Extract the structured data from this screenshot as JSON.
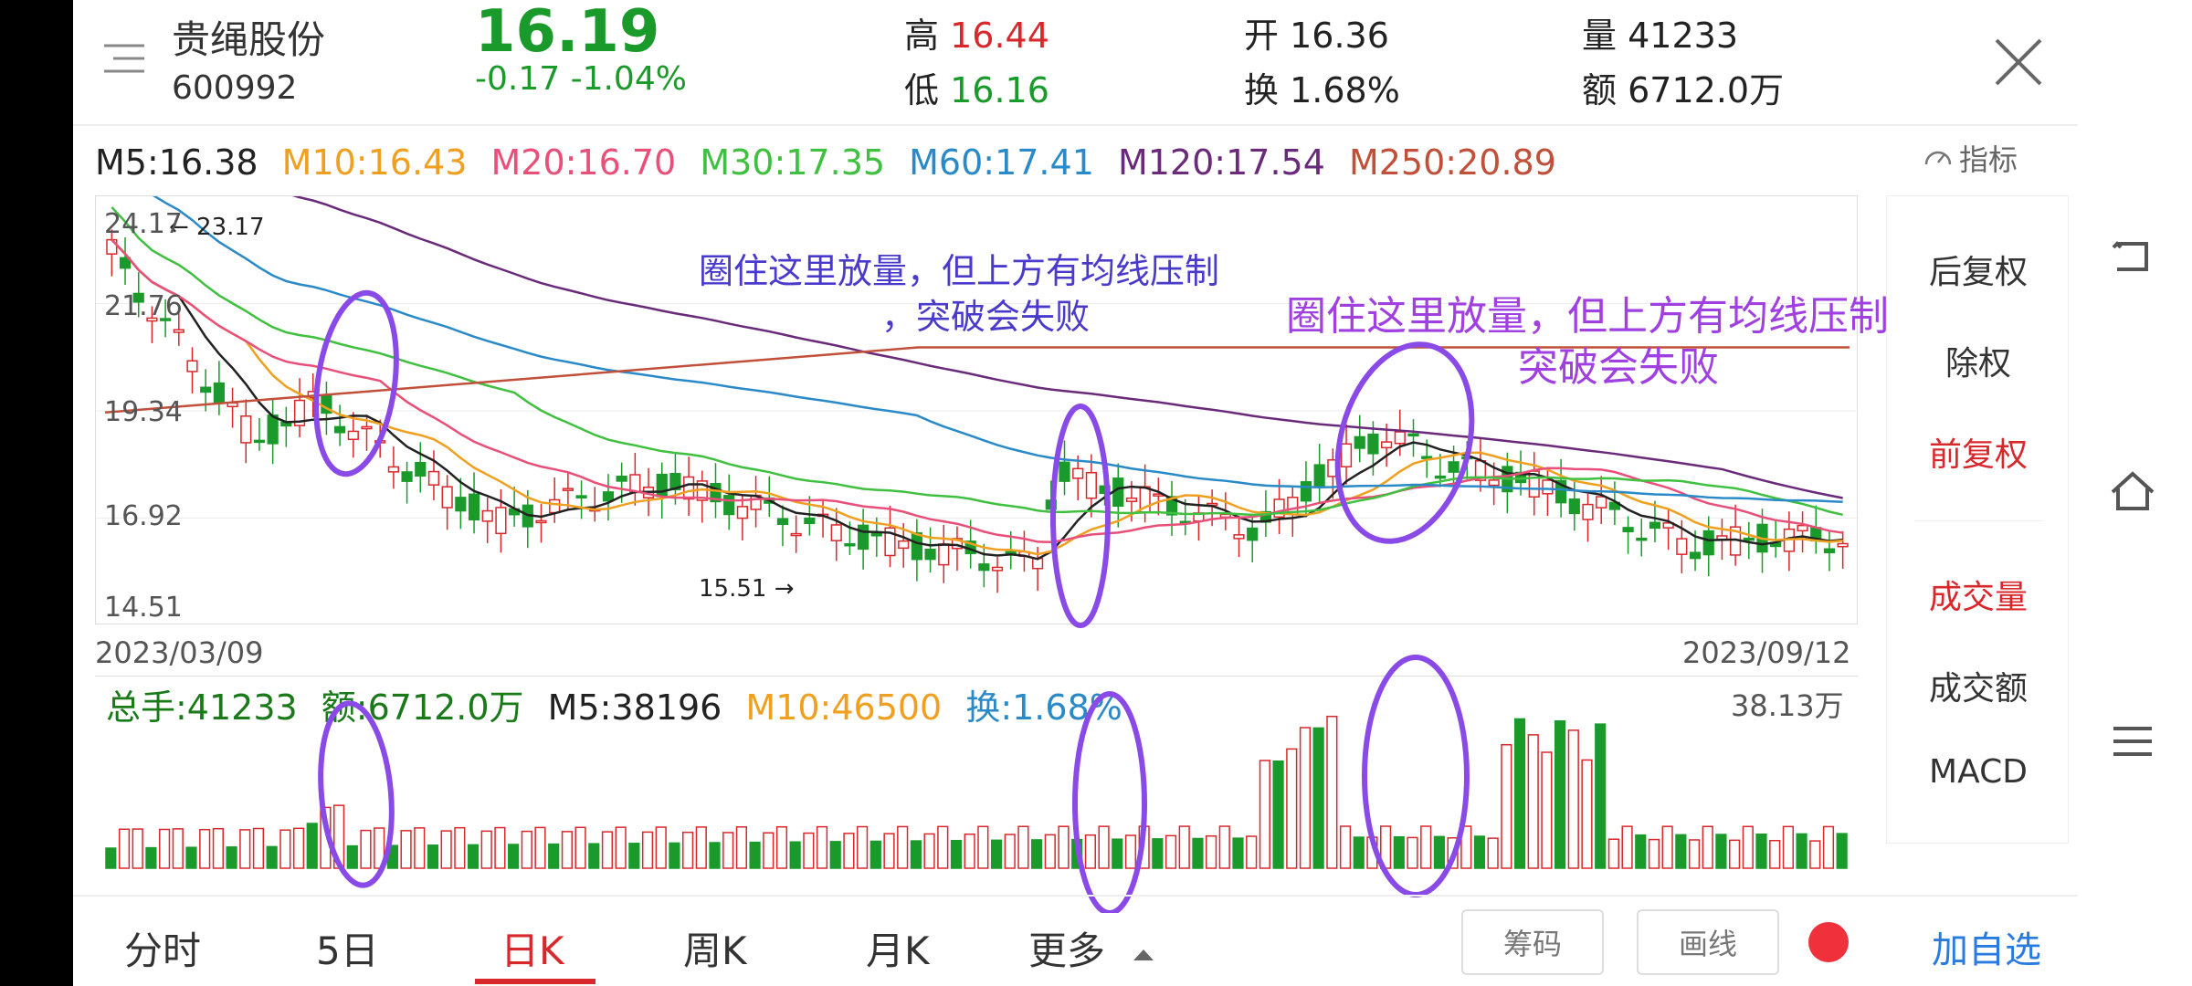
{
  "header": {
    "stock_name": "贵绳股份",
    "stock_code": "600992",
    "price": "16.19",
    "change": "-0.17  -1.04%",
    "high_label": "高",
    "high_value": "16.44",
    "low_label": "低",
    "low_value": "16.16",
    "open_label": "开",
    "open_value": "16.36",
    "turnover_label": "换",
    "turnover_value": "1.68%",
    "volume_label": "量",
    "volume_value": "41233",
    "amount_label": "额",
    "amount_value": "6712.0万"
  },
  "ma": {
    "m5": "M5:16.38",
    "m10": "M10:16.43",
    "m20": "M20:16.70",
    "m30": "M30:17.35",
    "m60": "M60:17.41",
    "m120": "M120:17.54",
    "m250": "M250:20.89",
    "indicator_label": "指标"
  },
  "axis": {
    "y_labels": [
      "24.17",
      "21.76",
      "19.34",
      "16.92",
      "14.51"
    ],
    "start_date": "2023/03/09",
    "end_date": "2023/09/12",
    "high_marker": "23.17",
    "low_marker": "15.51"
  },
  "volume": {
    "total": "总手:41233",
    "amount": "额:6712.0万",
    "m5": "M5:38196",
    "m10": "M10:46500",
    "turnover": "换:1.68%",
    "max": "38.13万"
  },
  "side_menu": {
    "items": [
      "后复权",
      "除权",
      "前复权",
      "成交量",
      "成交额",
      "MACD"
    ]
  },
  "annotations": {
    "a1_line1": "圈住这里放量，但上方有均线压制",
    "a1_line2": "，突破会失败",
    "a2_line1": "圈住这里放量，但上方有均线压制",
    "a2_line2": "突破会失败"
  },
  "tabs": [
    "分时",
    "5日",
    "日K",
    "周K",
    "月K",
    "更多"
  ],
  "buttons": {
    "chips": "筹码",
    "draw": "画线",
    "add_watch": "加自选"
  },
  "colors": {
    "up": "#d8282c",
    "down": "#1a9a2a",
    "m5": "#222222",
    "m10": "#f0a020",
    "m20": "#e8507a",
    "m30": "#40c040",
    "m60": "#2a8ac8",
    "m120": "#6a2a7a",
    "m250": "#c0503a",
    "annotation1": "#4a3acb",
    "annotation2": "#a040e0"
  }
}
